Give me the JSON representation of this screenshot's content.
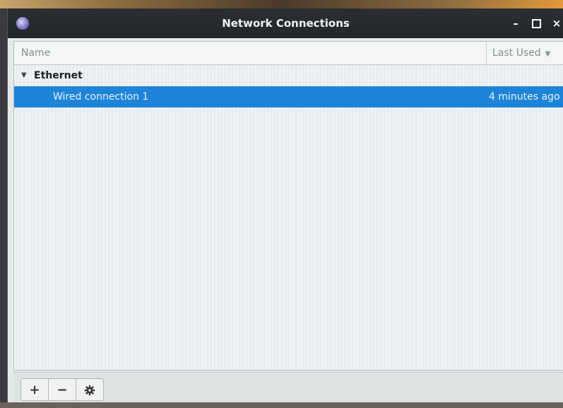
{
  "window": {
    "title": "Network Connections"
  },
  "titlebar_controls": {
    "minimize": "–",
    "close": "×"
  },
  "columns": {
    "name": "Name",
    "last_used": "Last Used"
  },
  "groups": [
    {
      "label": "Ethernet",
      "connections": [
        {
          "name": "Wired connection 1",
          "last_used": "4 minutes ago",
          "selected": true
        }
      ]
    }
  ],
  "toolbar": {
    "add_label": "+",
    "remove_label": "−",
    "settings_icon": "gear-icon"
  },
  "colors": {
    "selection": "#1d84d8",
    "titlebar": "#2b2e33"
  }
}
